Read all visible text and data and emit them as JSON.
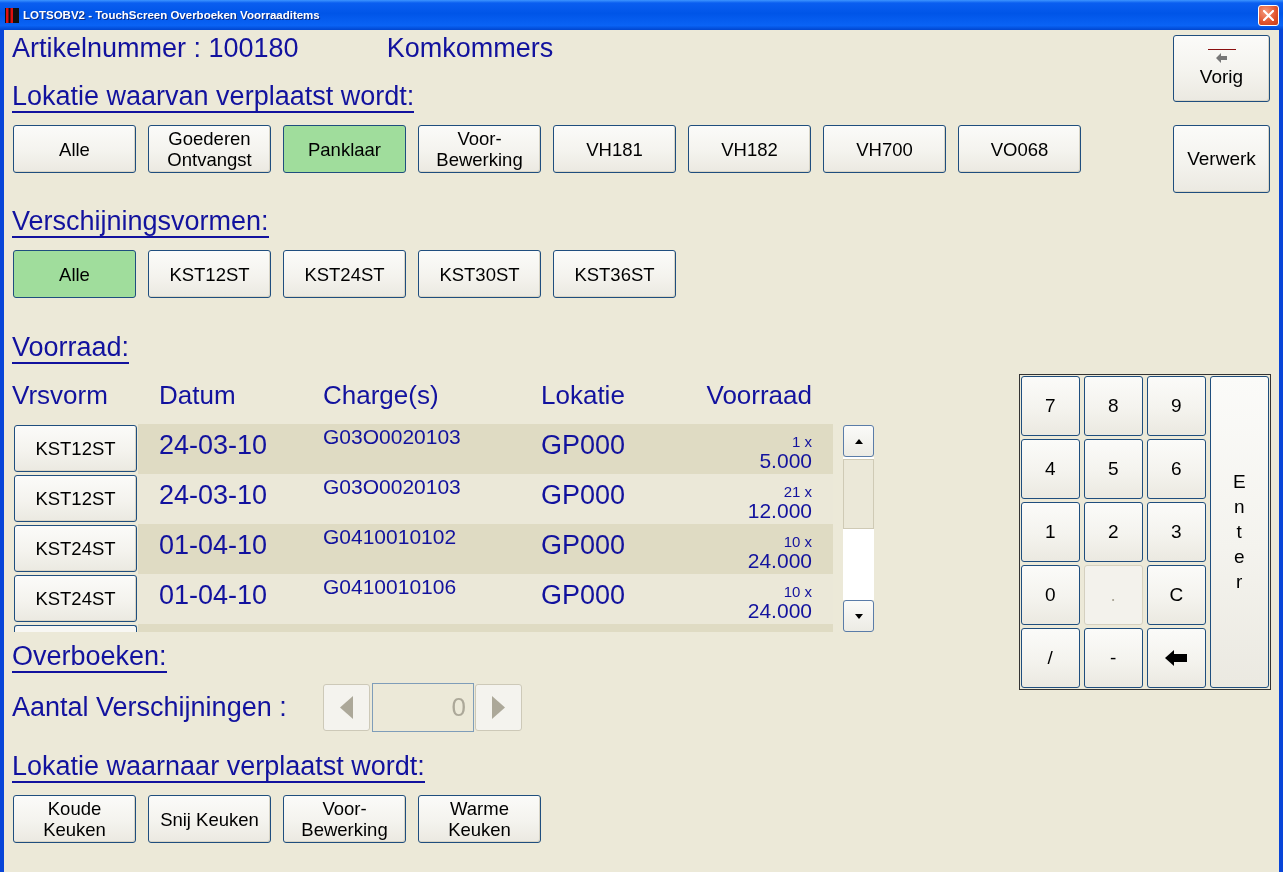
{
  "window": {
    "title": "LOTSOBV2 - TouchScreen Overboeken Voorraaditems"
  },
  "article": {
    "number": "Artikelnummer : 100180",
    "name": "Komkommers"
  },
  "source_locations": {
    "heading": "Lokatie waarvan verplaatst wordt:",
    "buttons": [
      {
        "label": "Alle",
        "selected": false
      },
      {
        "label": "Goederen Ontvangst",
        "selected": false
      },
      {
        "label": "Panklaar",
        "selected": true
      },
      {
        "label": "Voor-Bewerking",
        "selected": false
      },
      {
        "label": "VH181",
        "selected": false
      },
      {
        "label": "VH182",
        "selected": false
      },
      {
        "label": "VH700",
        "selected": false
      },
      {
        "label": "VO068",
        "selected": false
      }
    ]
  },
  "forms": {
    "heading": "Verschijningsvormen:",
    "buttons": [
      {
        "label": "Alle",
        "selected": true
      },
      {
        "label": "KST12ST",
        "selected": false
      },
      {
        "label": "KST24ST",
        "selected": false
      },
      {
        "label": "KST30ST",
        "selected": false
      },
      {
        "label": "KST36ST",
        "selected": false
      }
    ]
  },
  "stock": {
    "heading": "Voorraad:",
    "columns": [
      "Vrsvorm",
      "Datum",
      "Charge(s)",
      "Lokatie",
      "Voorraad"
    ],
    "rows": [
      {
        "form": "KST12ST",
        "date": "24-03-10",
        "charge": "G03O0020103",
        "location": "GP000",
        "count": "1 x",
        "quantity": "5.000"
      },
      {
        "form": "KST12ST",
        "date": "24-03-10",
        "charge": "G03O0020103",
        "location": "GP000",
        "count": "21 x",
        "quantity": "12.000"
      },
      {
        "form": "KST24ST",
        "date": "01-04-10",
        "charge": "G0410010102",
        "location": "GP000",
        "count": "10 x",
        "quantity": "24.000"
      },
      {
        "form": "KST24ST",
        "date": "01-04-10",
        "charge": "G0410010106",
        "location": "GP000",
        "count": "10 x",
        "quantity": "24.000"
      }
    ]
  },
  "transfer": {
    "heading": "Overboeken:",
    "label": "Aantal Verschijningen :",
    "spinner": {
      "value": "0",
      "disabled": true
    }
  },
  "destinations": {
    "heading": "Lokatie waarnaar verplaatst wordt:",
    "buttons": [
      {
        "label": "Koude Keuken",
        "selected": false
      },
      {
        "label": "Snij Keuken",
        "selected": false
      },
      {
        "label": "Voor-Bewerking",
        "selected": false
      },
      {
        "label": "Warme Keuken",
        "selected": false
      }
    ]
  },
  "side_buttons": [
    {
      "kind": "back",
      "label": "Vorig"
    },
    {
      "kind": "plain",
      "label": "Verwerk"
    }
  ],
  "keypad": {
    "keys": [
      {
        "kind": "text",
        "label": "7",
        "disabled": false
      },
      {
        "kind": "text",
        "label": "8",
        "disabled": false
      },
      {
        "kind": "text",
        "label": "9",
        "disabled": false
      },
      {
        "kind": "text",
        "label": "4",
        "disabled": false
      },
      {
        "kind": "text",
        "label": "5",
        "disabled": false
      },
      {
        "kind": "text",
        "label": "6",
        "disabled": false
      },
      {
        "kind": "text",
        "label": "1",
        "disabled": false
      },
      {
        "kind": "text",
        "label": "2",
        "disabled": false
      },
      {
        "kind": "text",
        "label": "3",
        "disabled": false
      },
      {
        "kind": "text",
        "label": "0",
        "disabled": false
      },
      {
        "kind": "text",
        "label": ".",
        "disabled": true
      },
      {
        "kind": "text",
        "label": "C",
        "disabled": false
      },
      {
        "kind": "text",
        "label": "/",
        "disabled": false
      },
      {
        "kind": "text",
        "label": "-",
        "disabled": false
      },
      {
        "kind": "backspace",
        "disabled": false
      }
    ],
    "enter": "Enter"
  }
}
